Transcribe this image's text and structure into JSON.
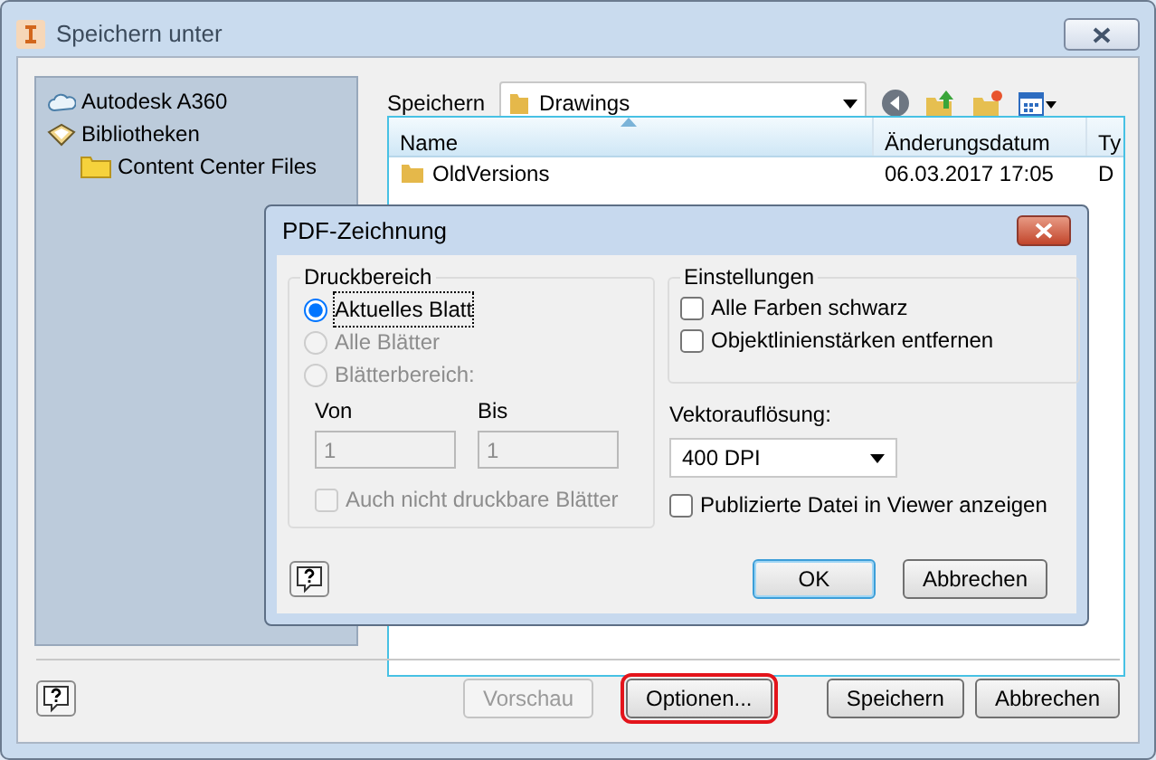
{
  "window": {
    "title": "Speichern unter"
  },
  "sidebar": {
    "items": [
      {
        "label": "Autodesk A360",
        "kind": "cloud"
      },
      {
        "label": "Bibliotheken",
        "kind": "library",
        "children": [
          {
            "label": "Content Center Files",
            "kind": "folder"
          }
        ]
      }
    ]
  },
  "location": {
    "label": "Speichern",
    "value": "Drawings"
  },
  "file_list": {
    "columns": [
      {
        "label": "Name",
        "sorted": true
      },
      {
        "label": "Änderungsdatum",
        "sorted": false
      },
      {
        "label": "Ty",
        "sorted": false
      }
    ],
    "rows": [
      {
        "cells": [
          "OldVersions",
          "06.03.2017 17:05",
          "D"
        ]
      }
    ]
  },
  "middle_buttons": [
    {
      "label": "Vorschau",
      "disabled": true,
      "highlighted": false
    },
    {
      "label": "Optionen...",
      "disabled": false,
      "highlighted": true
    }
  ],
  "action_buttons": [
    {
      "label": "Speichern"
    },
    {
      "label": "Abbrechen"
    }
  ],
  "dialog": {
    "title": "PDF-Zeichnung",
    "print_range": {
      "title": "Druckbereich",
      "options": [
        {
          "label": "Aktuelles Blatt",
          "selected": true,
          "disabled": false
        },
        {
          "label": "Alle Blätter",
          "selected": false,
          "disabled": true
        },
        {
          "label": "Blätterbereich:",
          "selected": false,
          "disabled": true
        }
      ],
      "fields": [
        {
          "label": "Von",
          "value": "1",
          "disabled": true
        },
        {
          "label": "Bis",
          "value": "1",
          "disabled": true
        }
      ],
      "extra": {
        "label": "Auch nicht druckbare Blätter",
        "checked": false,
        "disabled": true
      }
    },
    "settings": {
      "title": "Einstellungen",
      "options": [
        {
          "label": "Alle Farben schwarz",
          "checked": false
        },
        {
          "label": "Objektlinienstärken entfernen",
          "checked": false
        }
      ]
    },
    "resolution": {
      "label": "Vektorauflösung:",
      "value": "400 DPI"
    },
    "viewer": {
      "label": "Publizierte Datei in Viewer anzeigen",
      "checked": false
    },
    "buttons": [
      {
        "label": "OK",
        "default": true
      },
      {
        "label": "Abbrechen",
        "default": false
      }
    ]
  }
}
